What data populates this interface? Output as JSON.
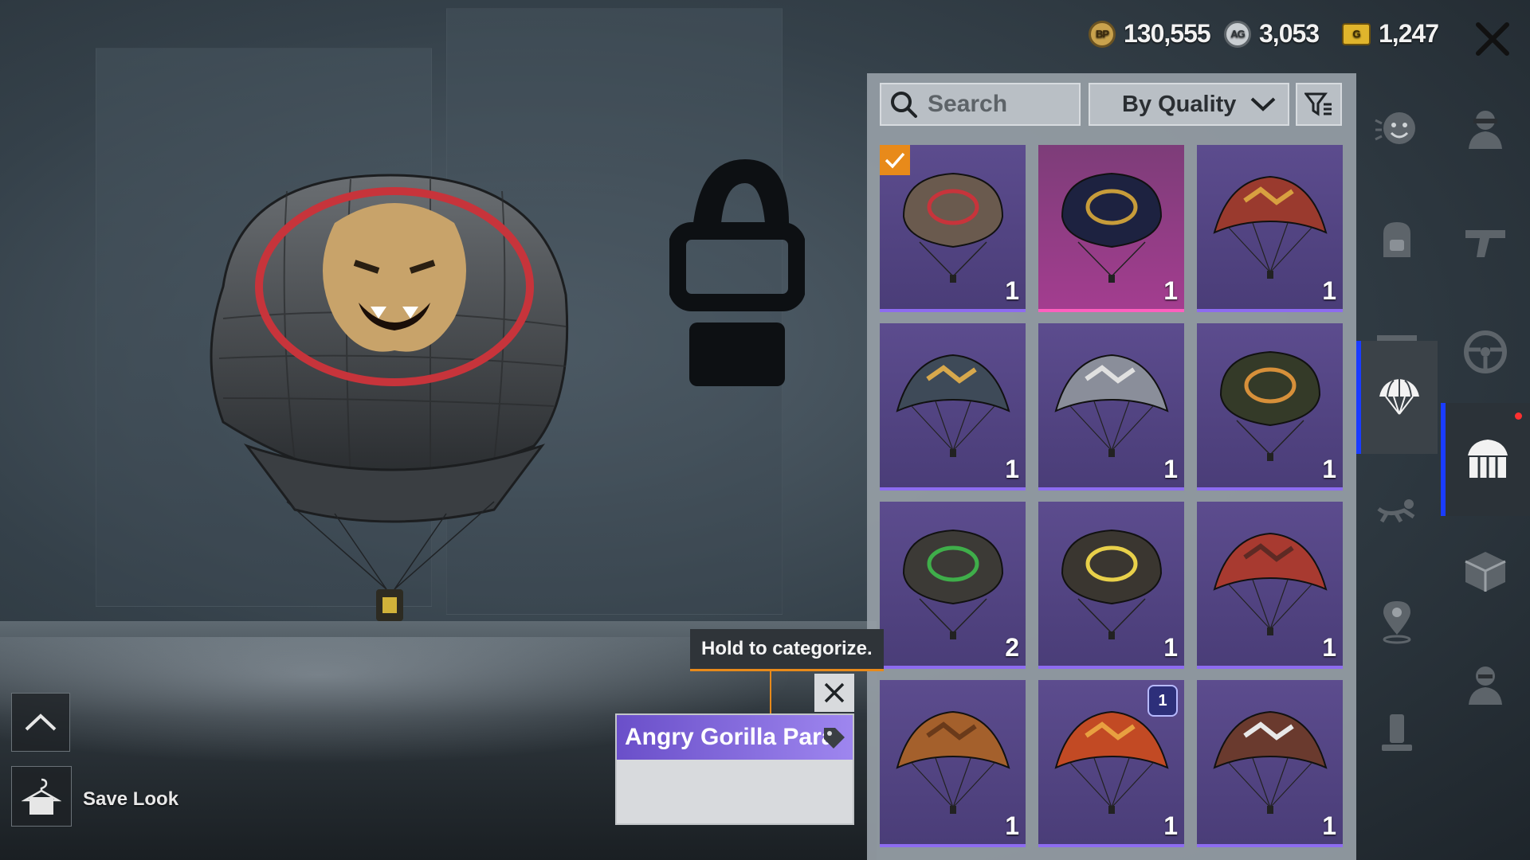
{
  "currencies": [
    {
      "icon": "bp-coin-icon",
      "badge": "BP",
      "value": "130,555"
    },
    {
      "icon": "ag-coin-icon",
      "badge": "AG",
      "value": "3,053"
    },
    {
      "icon": "g-coin-icon",
      "badge": "G",
      "value": "1,247"
    }
  ],
  "toolbar": {
    "search_placeholder": "Search",
    "sort_label": "By Quality"
  },
  "items": [
    {
      "qty": "1",
      "quality": "epic",
      "selected": true
    },
    {
      "qty": "1",
      "quality": "legendary"
    },
    {
      "qty": "1",
      "quality": "epic"
    },
    {
      "qty": "1",
      "quality": "epic"
    },
    {
      "qty": "1",
      "quality": "epic"
    },
    {
      "qty": "1",
      "quality": "epic"
    },
    {
      "qty": "2",
      "quality": "epic"
    },
    {
      "qty": "1",
      "quality": "epic"
    },
    {
      "qty": "1",
      "quality": "epic"
    },
    {
      "qty": "1",
      "quality": "epic"
    },
    {
      "qty": "1",
      "quality": "epic",
      "badge": "1"
    },
    {
      "qty": "1",
      "quality": "epic"
    }
  ],
  "tooltip": {
    "text": "Hold to categorize."
  },
  "selected_item": {
    "name": "Angry Gorilla Para"
  },
  "save_look": {
    "label": "Save Look"
  },
  "sidebar_inner": [
    "emote-icon",
    "backpack-icon",
    "glider-icon",
    "parachute-icon",
    "skydive-icon",
    "location-icon",
    "radio-icon"
  ],
  "sidebar_outer": [
    "character-icon",
    "gun-icon",
    "steering-wheel-icon",
    "vehicle-skin-icon",
    "crate-icon",
    "companion-icon"
  ],
  "colors": {
    "accent": "#e88a1a",
    "epic": "#8d6cf0",
    "legendary": "#ff5fbf",
    "active_tab": "#1a3cff"
  }
}
